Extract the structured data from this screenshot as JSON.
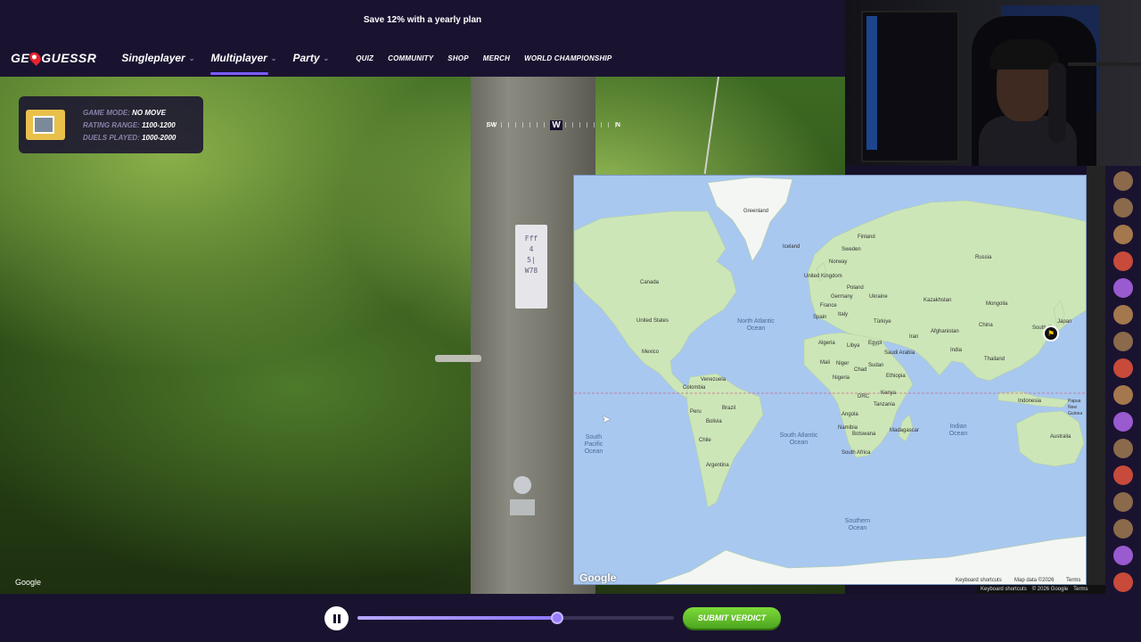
{
  "promo": {
    "text": "Save 12% with a yearly plan"
  },
  "nav": {
    "logo": {
      "left": "GE",
      "right": "GUESSR"
    },
    "main": [
      {
        "label": "Singleplayer",
        "active": false
      },
      {
        "label": "Multiplayer",
        "active": true
      },
      {
        "label": "Party",
        "active": false
      }
    ],
    "links": [
      "QUIZ",
      "COMMUNITY",
      "SHOP",
      "MERCH",
      "WORLD CHAMPIONSHIP"
    ]
  },
  "game_info": {
    "rows": [
      {
        "label": "GAME MODE:",
        "value": "NO MOVE"
      },
      {
        "label": "RATING RANGE:",
        "value": "1100-1200"
      },
      {
        "label": "DUELS PLAYED:",
        "value": "1000-2000"
      }
    ]
  },
  "compass": {
    "left": "SW",
    "center": "W",
    "right": "N"
  },
  "street_view": {
    "attribution": "Google",
    "sign_lines": [
      "Fff",
      "4",
      "5|",
      "W78"
    ]
  },
  "map": {
    "countries": [
      {
        "name": "Greenland",
        "id": "greenland"
      },
      {
        "name": "Iceland",
        "id": "iceland"
      },
      {
        "name": "Finland",
        "id": "finland"
      },
      {
        "name": "Sweden",
        "id": "sweden"
      },
      {
        "name": "Norway",
        "id": "norway"
      },
      {
        "name": "Russia",
        "id": "russia"
      },
      {
        "name": "Canada",
        "id": "canada"
      },
      {
        "name": "United Kingdom",
        "id": "uk"
      },
      {
        "name": "Poland",
        "id": "poland"
      },
      {
        "name": "Germany",
        "id": "germany"
      },
      {
        "name": "Ukraine",
        "id": "ukraine"
      },
      {
        "name": "Kazakhstan",
        "id": "kazakhstan"
      },
      {
        "name": "France",
        "id": "france"
      },
      {
        "name": "Mongolia",
        "id": "mongolia"
      },
      {
        "name": "Spain",
        "id": "spain"
      },
      {
        "name": "Italy",
        "id": "italy"
      },
      {
        "name": "Türkiye",
        "id": "turkiye"
      },
      {
        "name": "United States",
        "id": "us"
      },
      {
        "name": "China",
        "id": "china"
      },
      {
        "name": "Iran",
        "id": "iran"
      },
      {
        "name": "Afghanistan",
        "id": "afghanistan"
      },
      {
        "name": "Japan",
        "id": "japan"
      },
      {
        "name": "South K",
        "id": "south-korea"
      },
      {
        "name": "Algeria",
        "id": "algeria"
      },
      {
        "name": "Libya",
        "id": "libya"
      },
      {
        "name": "Egypt",
        "id": "egypt"
      },
      {
        "name": "Saudi Arabia",
        "id": "saudi"
      },
      {
        "name": "India",
        "id": "india"
      },
      {
        "name": "Mexico",
        "id": "mexico"
      },
      {
        "name": "Mali",
        "id": "mali"
      },
      {
        "name": "Niger",
        "id": "niger"
      },
      {
        "name": "Chad",
        "id": "chad"
      },
      {
        "name": "Sudan",
        "id": "sudan"
      },
      {
        "name": "Thailand",
        "id": "thailand"
      },
      {
        "name": "Nigeria",
        "id": "nigeria"
      },
      {
        "name": "Ethiopia",
        "id": "ethiopia"
      },
      {
        "name": "Venezuela",
        "id": "venezuela"
      },
      {
        "name": "Colombia",
        "id": "colombia"
      },
      {
        "name": "DRC",
        "id": "drc"
      },
      {
        "name": "Kenya",
        "id": "kenya"
      },
      {
        "name": "Indonesia",
        "id": "indonesia"
      },
      {
        "name": "Papua New Guinea",
        "id": "png"
      },
      {
        "name": "Brazil",
        "id": "brazil"
      },
      {
        "name": "Tanzania",
        "id": "tanzania"
      },
      {
        "name": "Peru",
        "id": "peru"
      },
      {
        "name": "Angola",
        "id": "angola"
      },
      {
        "name": "Bolivia",
        "id": "bolivia"
      },
      {
        "name": "Madagascar",
        "id": "madagascar"
      },
      {
        "name": "Namibia",
        "id": "namibia"
      },
      {
        "name": "Botswana",
        "id": "botswana"
      },
      {
        "name": "Australia",
        "id": "australia"
      },
      {
        "name": "Chile",
        "id": "chile"
      },
      {
        "name": "South Africa",
        "id": "south-africa"
      },
      {
        "name": "Argentina",
        "id": "argentina"
      }
    ],
    "oceans": [
      {
        "name": "North Atlantic Ocean",
        "id": "north-atlantic"
      },
      {
        "name": "South Pacific Ocean",
        "id": "south-pacific"
      },
      {
        "name": "South Atlantic Ocean",
        "id": "south-atlantic"
      },
      {
        "name": "Indian Ocean",
        "id": "indian"
      },
      {
        "name": "Southern Ocean",
        "id": "southern"
      }
    ],
    "google_logo": "Google",
    "legal": {
      "shortcuts": "Keyboard shortcuts",
      "data": "Map data ©2026",
      "terms": "Terms"
    }
  },
  "map_attr": {
    "shortcuts": "Keyboard shortcuts",
    "data": "© 2026 Google",
    "terms": "Terms"
  },
  "replay": {
    "progress": 0.63
  },
  "submit": {
    "label": "SUBMIT VERDICT"
  },
  "colors": {
    "accent": "#7b5cff",
    "submit": "#5cc12a",
    "bg": "#1a1330",
    "ocean": "#a8c8f0",
    "land": "#cde6b8"
  }
}
